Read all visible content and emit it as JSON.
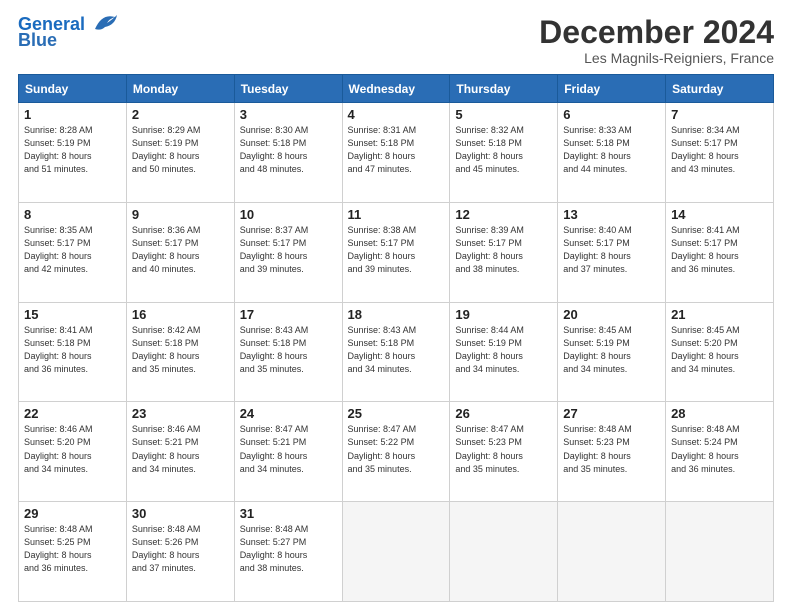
{
  "header": {
    "logo_line1": "General",
    "logo_line2": "Blue",
    "title": "December 2024",
    "subtitle": "Les Magnils-Reigniers, France"
  },
  "columns": [
    "Sunday",
    "Monday",
    "Tuesday",
    "Wednesday",
    "Thursday",
    "Friday",
    "Saturday"
  ],
  "weeks": [
    [
      {
        "day": "1",
        "sunrise": "8:28 AM",
        "sunset": "5:19 PM",
        "daylight": "8 hours and 51 minutes."
      },
      {
        "day": "2",
        "sunrise": "8:29 AM",
        "sunset": "5:19 PM",
        "daylight": "8 hours and 50 minutes."
      },
      {
        "day": "3",
        "sunrise": "8:30 AM",
        "sunset": "5:18 PM",
        "daylight": "8 hours and 48 minutes."
      },
      {
        "day": "4",
        "sunrise": "8:31 AM",
        "sunset": "5:18 PM",
        "daylight": "8 hours and 47 minutes."
      },
      {
        "day": "5",
        "sunrise": "8:32 AM",
        "sunset": "5:18 PM",
        "daylight": "8 hours and 45 minutes."
      },
      {
        "day": "6",
        "sunrise": "8:33 AM",
        "sunset": "5:18 PM",
        "daylight": "8 hours and 44 minutes."
      },
      {
        "day": "7",
        "sunrise": "8:34 AM",
        "sunset": "5:17 PM",
        "daylight": "8 hours and 43 minutes."
      }
    ],
    [
      {
        "day": "8",
        "sunrise": "8:35 AM",
        "sunset": "5:17 PM",
        "daylight": "8 hours and 42 minutes."
      },
      {
        "day": "9",
        "sunrise": "8:36 AM",
        "sunset": "5:17 PM",
        "daylight": "8 hours and 40 minutes."
      },
      {
        "day": "10",
        "sunrise": "8:37 AM",
        "sunset": "5:17 PM",
        "daylight": "8 hours and 39 minutes."
      },
      {
        "day": "11",
        "sunrise": "8:38 AM",
        "sunset": "5:17 PM",
        "daylight": "8 hours and 39 minutes."
      },
      {
        "day": "12",
        "sunrise": "8:39 AM",
        "sunset": "5:17 PM",
        "daylight": "8 hours and 38 minutes."
      },
      {
        "day": "13",
        "sunrise": "8:40 AM",
        "sunset": "5:17 PM",
        "daylight": "8 hours and 37 minutes."
      },
      {
        "day": "14",
        "sunrise": "8:41 AM",
        "sunset": "5:17 PM",
        "daylight": "8 hours and 36 minutes."
      }
    ],
    [
      {
        "day": "15",
        "sunrise": "8:41 AM",
        "sunset": "5:18 PM",
        "daylight": "8 hours and 36 minutes."
      },
      {
        "day": "16",
        "sunrise": "8:42 AM",
        "sunset": "5:18 PM",
        "daylight": "8 hours and 35 minutes."
      },
      {
        "day": "17",
        "sunrise": "8:43 AM",
        "sunset": "5:18 PM",
        "daylight": "8 hours and 35 minutes."
      },
      {
        "day": "18",
        "sunrise": "8:43 AM",
        "sunset": "5:18 PM",
        "daylight": "8 hours and 34 minutes."
      },
      {
        "day": "19",
        "sunrise": "8:44 AM",
        "sunset": "5:19 PM",
        "daylight": "8 hours and 34 minutes."
      },
      {
        "day": "20",
        "sunrise": "8:45 AM",
        "sunset": "5:19 PM",
        "daylight": "8 hours and 34 minutes."
      },
      {
        "day": "21",
        "sunrise": "8:45 AM",
        "sunset": "5:20 PM",
        "daylight": "8 hours and 34 minutes."
      }
    ],
    [
      {
        "day": "22",
        "sunrise": "8:46 AM",
        "sunset": "5:20 PM",
        "daylight": "8 hours and 34 minutes."
      },
      {
        "day": "23",
        "sunrise": "8:46 AM",
        "sunset": "5:21 PM",
        "daylight": "8 hours and 34 minutes."
      },
      {
        "day": "24",
        "sunrise": "8:47 AM",
        "sunset": "5:21 PM",
        "daylight": "8 hours and 34 minutes."
      },
      {
        "day": "25",
        "sunrise": "8:47 AM",
        "sunset": "5:22 PM",
        "daylight": "8 hours and 35 minutes."
      },
      {
        "day": "26",
        "sunrise": "8:47 AM",
        "sunset": "5:23 PM",
        "daylight": "8 hours and 35 minutes."
      },
      {
        "day": "27",
        "sunrise": "8:48 AM",
        "sunset": "5:23 PM",
        "daylight": "8 hours and 35 minutes."
      },
      {
        "day": "28",
        "sunrise": "8:48 AM",
        "sunset": "5:24 PM",
        "daylight": "8 hours and 36 minutes."
      }
    ],
    [
      {
        "day": "29",
        "sunrise": "8:48 AM",
        "sunset": "5:25 PM",
        "daylight": "8 hours and 36 minutes."
      },
      {
        "day": "30",
        "sunrise": "8:48 AM",
        "sunset": "5:26 PM",
        "daylight": "8 hours and 37 minutes."
      },
      {
        "day": "31",
        "sunrise": "8:48 AM",
        "sunset": "5:27 PM",
        "daylight": "8 hours and 38 minutes."
      },
      null,
      null,
      null,
      null
    ]
  ]
}
